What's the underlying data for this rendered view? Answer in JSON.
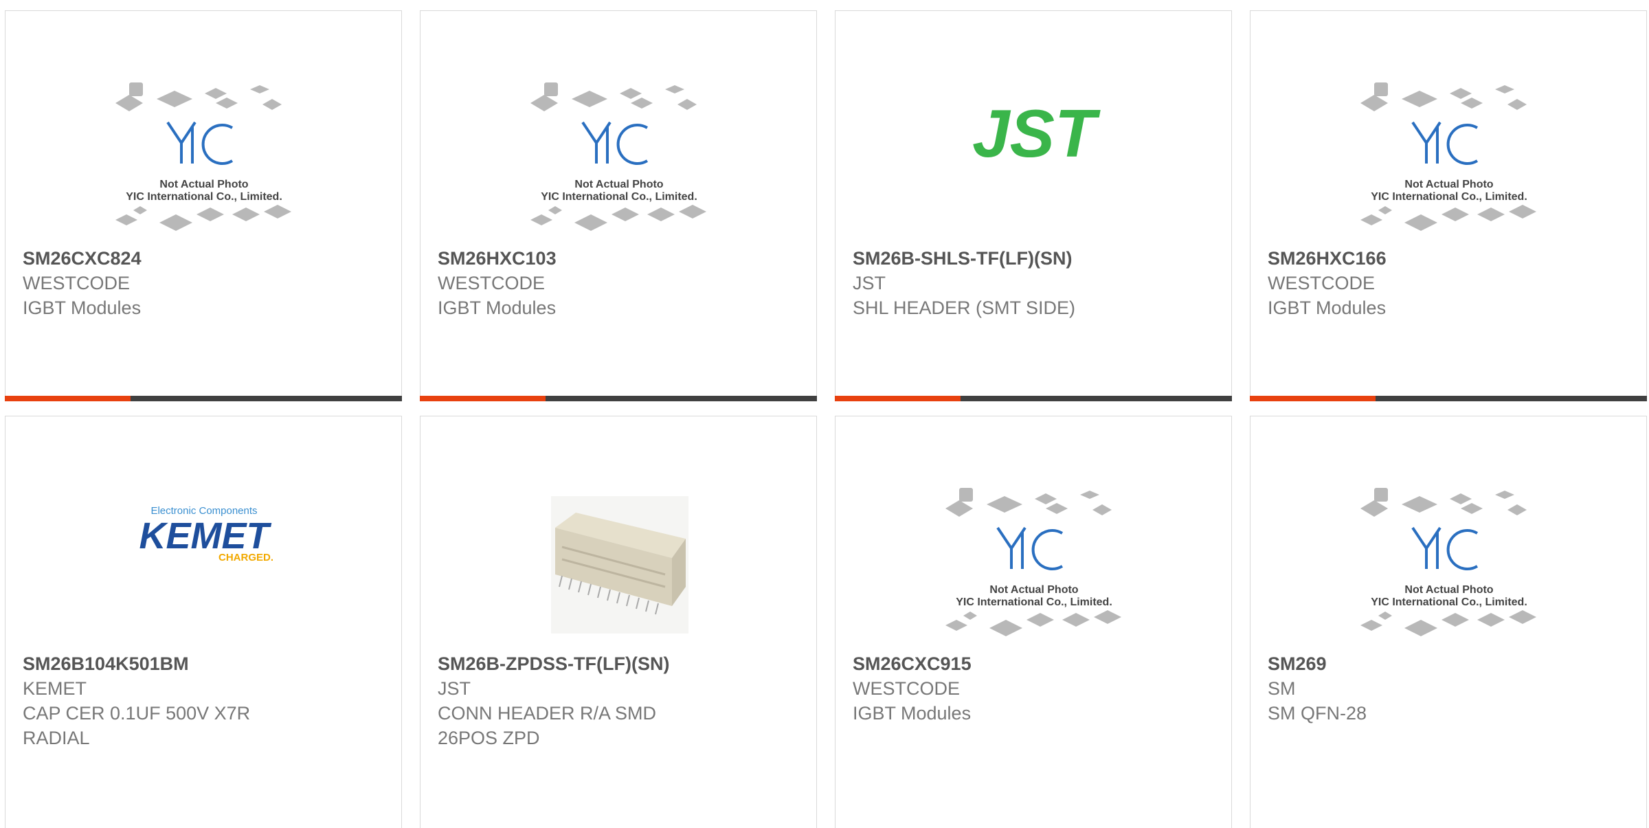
{
  "products": [
    {
      "part": "SM26CXC824",
      "maker": "WESTCODE",
      "desc": "IGBT Modules",
      "image": "yic-placeholder-icon"
    },
    {
      "part": "SM26HXC103",
      "maker": "WESTCODE",
      "desc": "IGBT Modules",
      "image": "yic-placeholder-icon"
    },
    {
      "part": "SM26B-SHLS-TF(LF)(SN)",
      "maker": "JST",
      "desc": "SHL HEADER (SMT SIDE)",
      "image": "jst-logo-icon"
    },
    {
      "part": "SM26HXC166",
      "maker": "WESTCODE",
      "desc": "IGBT Modules",
      "image": "yic-placeholder-icon"
    },
    {
      "part": "SM26B104K501BM",
      "maker": "KEMET",
      "desc": "CAP CER 0.1UF 500V X7R\nRADIAL",
      "image": "kemet-logo-icon"
    },
    {
      "part": "SM26B-ZPDSS-TF(LF)(SN)",
      "maker": "JST",
      "desc": "CONN HEADER R/A SMD\n26POS ZPD",
      "image": "connector-photo-icon"
    },
    {
      "part": "SM26CXC915",
      "maker": "WESTCODE",
      "desc": "IGBT Modules",
      "image": "yic-placeholder-icon"
    },
    {
      "part": "SM269",
      "maker": "SM",
      "desc": "SM QFN-28",
      "image": "yic-placeholder-icon"
    }
  ],
  "placeholder": {
    "logo": "YIC",
    "line1": "Not Actual Photo",
    "line2": "YIC International Co., Limited."
  },
  "logos": {
    "jst": "JST",
    "kemet_top": "Electronic Components",
    "kemet_main": "KEMET",
    "kemet_bottom": "CHARGED."
  },
  "colors": {
    "accent": "#e8410f",
    "bar": "#404040",
    "jst_green": "#3ab54a",
    "kemet_blue": "#1e4e9c",
    "kemet_gold": "#f2a900",
    "yic_blue": "#2a6fc0"
  }
}
